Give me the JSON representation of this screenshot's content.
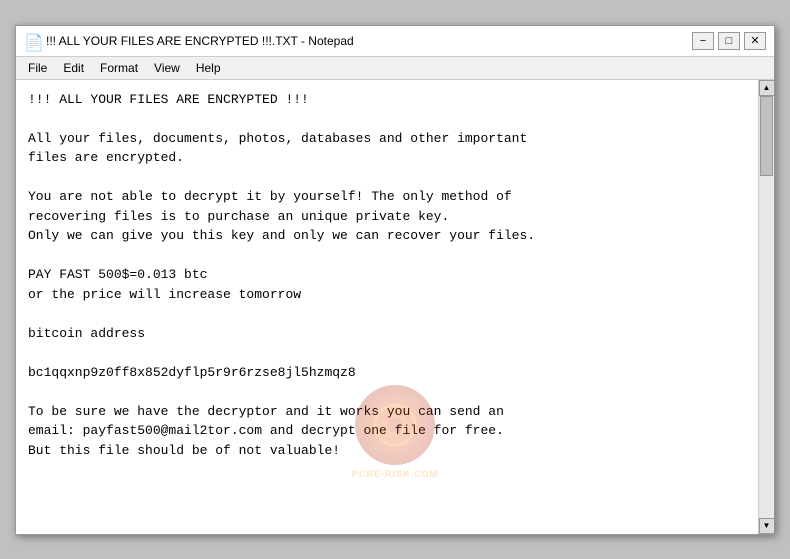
{
  "window": {
    "title": "!!! ALL YOUR FILES ARE ENCRYPTED !!!.TXT - Notepad",
    "icon": "📄"
  },
  "titlebar": {
    "minimize_label": "−",
    "maximize_label": "□",
    "close_label": "✕"
  },
  "menubar": {
    "items": [
      "File",
      "Edit",
      "Format",
      "View",
      "Help"
    ]
  },
  "content": {
    "text": "!!! ALL YOUR FILES ARE ENCRYPTED !!!\n\nAll your files, documents, photos, databases and other important\nfiles are encrypted.\n\nYou are not able to decrypt it by yourself! The only method of\nrecovering files is to purchase an unique private key.\nOnly we can give you this key and only we can recover your files.\n\nPAY FAST 500$=0.013 btc\nor the price will increase tomorrow\n\nbitcoin address\n\nbc1qqxnp9z0ff8x852dyflp5r9r6rzse8jl5hzmqz8\n\nTo be sure we have the decryptor and it works you can send an\nemail: payfast500@mail2tor.com and decrypt one file for free.\nBut this file should be of not valuable!"
  },
  "watermark": {
    "text": "PCRE-RISK.COM"
  }
}
